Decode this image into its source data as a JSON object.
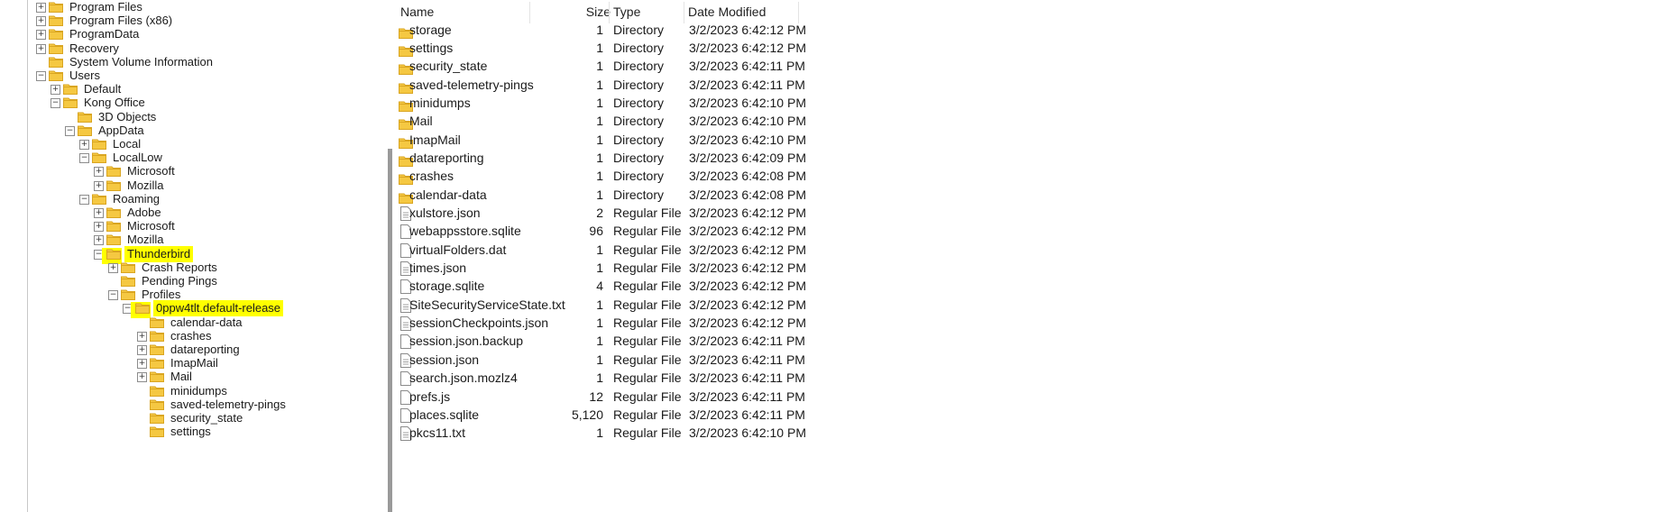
{
  "tree": {
    "items": [
      {
        "label": "Program Files",
        "expander": "+"
      },
      {
        "label": "Program Files (x86)",
        "expander": "+"
      },
      {
        "label": "ProgramData",
        "expander": "+"
      },
      {
        "label": "Recovery",
        "expander": "+"
      },
      {
        "label": "System Volume Information",
        "expander": ""
      },
      {
        "label": "Users",
        "expander": "−"
      },
      {
        "label": "Default",
        "expander": "+"
      },
      {
        "label": "Kong Office",
        "expander": "−"
      },
      {
        "label": "3D Objects",
        "expander": ""
      },
      {
        "label": "AppData",
        "expander": "−"
      },
      {
        "label": "Local",
        "expander": "+"
      },
      {
        "label": "LocalLow",
        "expander": "−"
      },
      {
        "label": "Microsoft",
        "expander": "+"
      },
      {
        "label": "Mozilla",
        "expander": "+"
      },
      {
        "label": "Roaming",
        "expander": "−"
      },
      {
        "label": "Adobe",
        "expander": "+"
      },
      {
        "label": "Microsoft",
        "expander": "+"
      },
      {
        "label": "Mozilla",
        "expander": "+"
      },
      {
        "label": "Thunderbird",
        "expander": "−",
        "highlighted": true
      },
      {
        "label": "Crash Reports",
        "expander": "+"
      },
      {
        "label": "Pending Pings",
        "expander": ""
      },
      {
        "label": "Profiles",
        "expander": "−"
      },
      {
        "label": "0ppw4tlt.default-release",
        "expander": "−",
        "highlighted": true
      },
      {
        "label": "calendar-data",
        "expander": ""
      },
      {
        "label": "crashes",
        "expander": "+"
      },
      {
        "label": "datareporting",
        "expander": "+"
      },
      {
        "label": "ImapMail",
        "expander": "+"
      },
      {
        "label": "Mail",
        "expander": "+"
      },
      {
        "label": "minidumps",
        "expander": ""
      },
      {
        "label": "saved-telemetry-pings",
        "expander": ""
      },
      {
        "label": "security_state",
        "expander": ""
      },
      {
        "label": "settings",
        "expander": ""
      }
    ]
  },
  "list": {
    "headers": {
      "name": "Name",
      "size": "Size",
      "type": "Type",
      "date": "Date Modified"
    },
    "rows": [
      {
        "name": "storage",
        "size": "1",
        "type": "Directory",
        "date": "3/2/2023 6:42:12 PM",
        "icon": "folder"
      },
      {
        "name": "settings",
        "size": "1",
        "type": "Directory",
        "date": "3/2/2023 6:42:12 PM",
        "icon": "folder"
      },
      {
        "name": "security_state",
        "size": "1",
        "type": "Directory",
        "date": "3/2/2023 6:42:11 PM",
        "icon": "folder"
      },
      {
        "name": "saved-telemetry-pings",
        "size": "1",
        "type": "Directory",
        "date": "3/2/2023 6:42:11 PM",
        "icon": "folder"
      },
      {
        "name": "minidumps",
        "size": "1",
        "type": "Directory",
        "date": "3/2/2023 6:42:10 PM",
        "icon": "folder"
      },
      {
        "name": "Mail",
        "size": "1",
        "type": "Directory",
        "date": "3/2/2023 6:42:10 PM",
        "icon": "folder"
      },
      {
        "name": "ImapMail",
        "size": "1",
        "type": "Directory",
        "date": "3/2/2023 6:42:10 PM",
        "icon": "folder"
      },
      {
        "name": "datareporting",
        "size": "1",
        "type": "Directory",
        "date": "3/2/2023 6:42:09 PM",
        "icon": "folder"
      },
      {
        "name": "crashes",
        "size": "1",
        "type": "Directory",
        "date": "3/2/2023 6:42:08 PM",
        "icon": "folder"
      },
      {
        "name": "calendar-data",
        "size": "1",
        "type": "Directory",
        "date": "3/2/2023 6:42:08 PM",
        "icon": "folder"
      },
      {
        "name": "xulstore.json",
        "size": "2",
        "type": "Regular File",
        "date": "3/2/2023 6:42:12 PM",
        "icon": "text-file"
      },
      {
        "name": "webappsstore.sqlite",
        "size": "96",
        "type": "Regular File",
        "date": "3/2/2023 6:42:12 PM",
        "icon": "file"
      },
      {
        "name": "virtualFolders.dat",
        "size": "1",
        "type": "Regular File",
        "date": "3/2/2023 6:42:12 PM",
        "icon": "file"
      },
      {
        "name": "times.json",
        "size": "1",
        "type": "Regular File",
        "date": "3/2/2023 6:42:12 PM",
        "icon": "text-file"
      },
      {
        "name": "storage.sqlite",
        "size": "4",
        "type": "Regular File",
        "date": "3/2/2023 6:42:12 PM",
        "icon": "file"
      },
      {
        "name": "SiteSecurityServiceState.txt",
        "size": "1",
        "type": "Regular File",
        "date": "3/2/2023 6:42:12 PM",
        "icon": "text-file"
      },
      {
        "name": "sessionCheckpoints.json",
        "size": "1",
        "type": "Regular File",
        "date": "3/2/2023 6:42:12 PM",
        "icon": "text-file"
      },
      {
        "name": "session.json.backup",
        "size": "1",
        "type": "Regular File",
        "date": "3/2/2023 6:42:11 PM",
        "icon": "file"
      },
      {
        "name": "session.json",
        "size": "1",
        "type": "Regular File",
        "date": "3/2/2023 6:42:11 PM",
        "icon": "text-file"
      },
      {
        "name": "search.json.mozlz4",
        "size": "1",
        "type": "Regular File",
        "date": "3/2/2023 6:42:11 PM",
        "icon": "file"
      },
      {
        "name": "prefs.js",
        "size": "12",
        "type": "Regular File",
        "date": "3/2/2023 6:42:11 PM",
        "icon": "file"
      },
      {
        "name": "places.sqlite",
        "size": "5,120",
        "type": "Regular File",
        "date": "3/2/2023 6:42:11 PM",
        "icon": "file"
      },
      {
        "name": "pkcs11.txt",
        "size": "1",
        "type": "Regular File",
        "date": "3/2/2023 6:42:10 PM",
        "icon": "text-file"
      }
    ]
  },
  "colors": {
    "highlight": "#ffff00",
    "folder": "#f5c842",
    "folder_dark": "#d9a521"
  }
}
